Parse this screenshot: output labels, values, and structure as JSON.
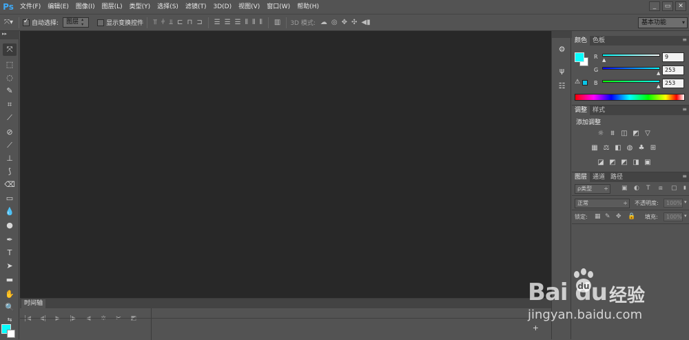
{
  "app": {
    "logo": "Ps"
  },
  "menu": [
    "文件(F)",
    "编辑(E)",
    "图像(I)",
    "图层(L)",
    "类型(Y)",
    "选择(S)",
    "滤镜(T)",
    "3D(D)",
    "视图(V)",
    "窗口(W)",
    "帮助(H)"
  ],
  "options": {
    "auto_select_label": "自动选择:",
    "auto_select_checked": true,
    "auto_select_value": "图层",
    "show_transform_label": "显示变换控件",
    "show_transform_checked": false,
    "mode_label": "3D 模式:",
    "workspace": "基本功能"
  },
  "colors": {
    "foreground": "#09fdfd",
    "background": "#ffffff",
    "canvas": "#282828",
    "chrome": "#535353"
  },
  "color_panel": {
    "tabs": [
      "颜色",
      "色板"
    ],
    "active_tab": 0,
    "channels": [
      {
        "label": "R",
        "value": "9"
      },
      {
        "label": "G",
        "value": "253"
      },
      {
        "label": "B",
        "value": "253"
      }
    ]
  },
  "adjust_panel": {
    "tabs": [
      "调整",
      "样式"
    ],
    "active_tab": 0,
    "title": "添加调整"
  },
  "layers_panel": {
    "tabs": [
      "图层",
      "通道",
      "路径"
    ],
    "active_tab": 0,
    "filter_kind": "ρ类型",
    "blend_mode": "正常",
    "opacity_label": "不透明度:",
    "opacity_value": "100%",
    "lock_label": "锁定:",
    "fill_label": "填充:",
    "fill_value": "100%"
  },
  "timeline": {
    "tab": "时间轴"
  },
  "watermark": {
    "logo": "Bai  du",
    "text": "经验",
    "url": "jingyan.baidu.com"
  }
}
